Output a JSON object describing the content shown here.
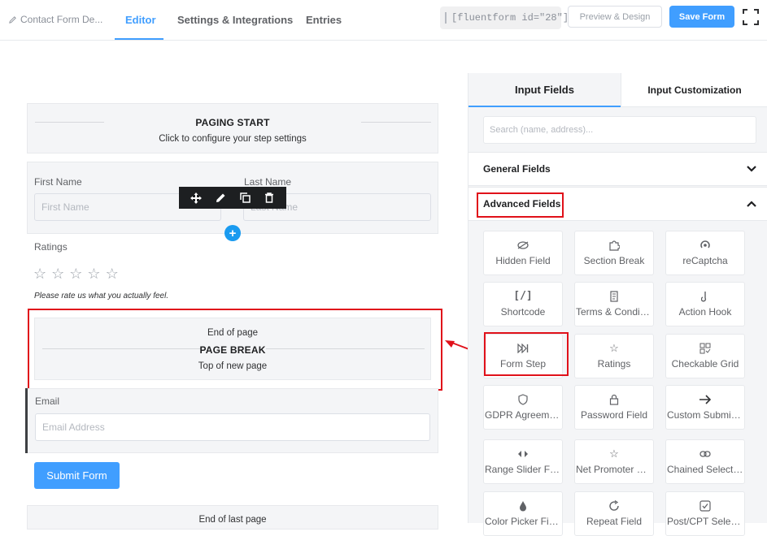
{
  "header": {
    "crumb": "Contact Form De...",
    "tabs": [
      "Editor",
      "Settings & Integrations",
      "Entries"
    ],
    "shortcode": "[fluentform id=\"28\"]",
    "preview_label": "Preview & Design",
    "save_label": "Save Form"
  },
  "canvas": {
    "paging_start_title": "PAGING START",
    "paging_start_sub": "Click to configure your step settings",
    "first_name_label": "First Name",
    "first_name_placeholder": "First Name",
    "last_name_label": "Last Name",
    "last_name_placeholder": "Last Name",
    "ratings_label": "Ratings",
    "ratings_help": "Please rate us what you actually feel.",
    "page_break_top": "End of page",
    "page_break_title": "PAGE BREAK",
    "page_break_bottom": "Top of new page",
    "email_label": "Email",
    "email_placeholder": "Email Address",
    "submit_label": "Submit Form",
    "end_last_page": "End of last page"
  },
  "panel": {
    "tabs": [
      "Input Fields",
      "Input Customization"
    ],
    "search_placeholder": "Search (name, address)...",
    "general_fields": "General Fields",
    "advanced_fields": "Advanced Fields",
    "fields": [
      {
        "label": "Hidden Field",
        "icon": "eye-slash-icon"
      },
      {
        "label": "Section Break",
        "icon": "puzzle-icon"
      },
      {
        "label": "reCaptcha",
        "icon": "recaptcha-icon"
      },
      {
        "label": "Shortcode",
        "icon": "shortcode-icon"
      },
      {
        "label": "Terms & Conditions",
        "icon": "scroll-icon"
      },
      {
        "label": "Action Hook",
        "icon": "hook-icon"
      },
      {
        "label": "Form Step",
        "icon": "step-forward-icon"
      },
      {
        "label": "Ratings",
        "icon": "star-icon"
      },
      {
        "label": "Checkable Grid",
        "icon": "grid-icon"
      },
      {
        "label": "GDPR Agreement",
        "icon": "shield-icon"
      },
      {
        "label": "Password Field",
        "icon": "lock-icon"
      },
      {
        "label": "Custom Submit Button",
        "icon": "arrow-right-icon"
      },
      {
        "label": "Range Slider Field",
        "icon": "range-icon"
      },
      {
        "label": "Net Promoter Score",
        "icon": "star-outline-icon"
      },
      {
        "label": "Chained Select Field",
        "icon": "link-icon"
      },
      {
        "label": "Color Picker Field",
        "icon": "drop-icon"
      },
      {
        "label": "Repeat Field",
        "icon": "repeat-icon"
      },
      {
        "label": "Post/CPT Selection",
        "icon": "checkbox-icon"
      }
    ]
  }
}
